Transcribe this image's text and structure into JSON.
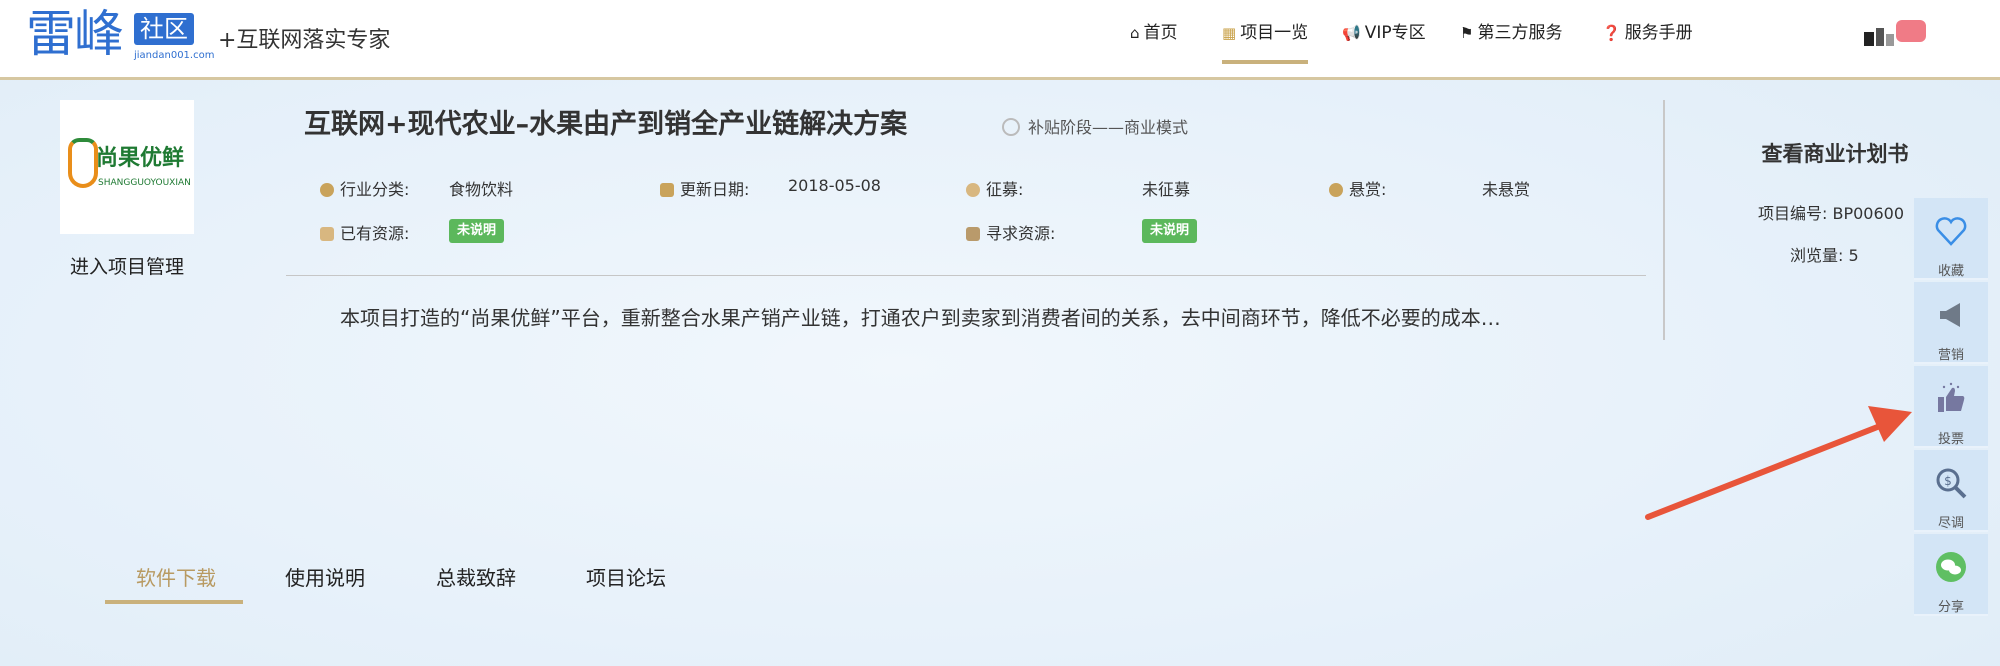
{
  "header": {
    "logo_main": "雷峰",
    "logo_badge": "社区",
    "logo_url": "jiandan001.com",
    "slogan": "+互联网落实专家",
    "nav": [
      {
        "label": "首页",
        "icon": "home-icon"
      },
      {
        "label": "项目一览",
        "icon": "grid-icon",
        "active": true
      },
      {
        "label": "VIP专区",
        "icon": "megaphone-icon"
      },
      {
        "label": "第三方服务",
        "icon": "flag-icon"
      },
      {
        "label": "服务手册",
        "icon": "question-icon"
      }
    ]
  },
  "project": {
    "logo_text": "尚果优鲜",
    "logo_subtext": "SHANGGUOYOUXIAN",
    "manage_link": "进入项目管理",
    "title": "互联网+现代农业–水果由产到销全产业链解决方案",
    "stage": "补贴阶段——商业模式",
    "fields": {
      "industry_label": "行业分类:",
      "industry_value": "食物饮料",
      "update_label": "更新日期:",
      "update_value": "2018-05-08",
      "collect_label": "征募:",
      "collect_value": "未征募",
      "reward_label": "悬赏:",
      "reward_value": "未悬赏",
      "have_label": "已有资源:",
      "have_value": "未说明",
      "seek_label": "寻求资源:",
      "seek_value": "未说明"
    },
    "description": "本项目打造的“尚果优鲜”平台，重新整合水果产销产业链，打通农户到卖家到消费者间的关系，去中间商环节，降低不必要的成本…"
  },
  "business_plan": {
    "title": "查看商业计划书",
    "project_no": "项目编号: BP00600",
    "views": "浏览量:  5"
  },
  "sidebar": [
    {
      "label": "收藏",
      "icon": "heart-icon"
    },
    {
      "label": "营销",
      "icon": "megaphone-icon"
    },
    {
      "label": "投票",
      "icon": "thumbs-up-icon"
    },
    {
      "label": "尽调",
      "icon": "magnifier-icon"
    },
    {
      "label": "分享",
      "icon": "wechat-icon"
    }
  ],
  "tabs": [
    {
      "label": "软件下载",
      "active": true
    },
    {
      "label": "使用说明"
    },
    {
      "label": "总裁致辞"
    },
    {
      "label": "项目论坛"
    }
  ],
  "colors": {
    "accent": "#c9b17c",
    "brand_blue": "#2f6fd0",
    "badge_green": "#5cb85c",
    "annotation_arrow": "#e8553a"
  }
}
